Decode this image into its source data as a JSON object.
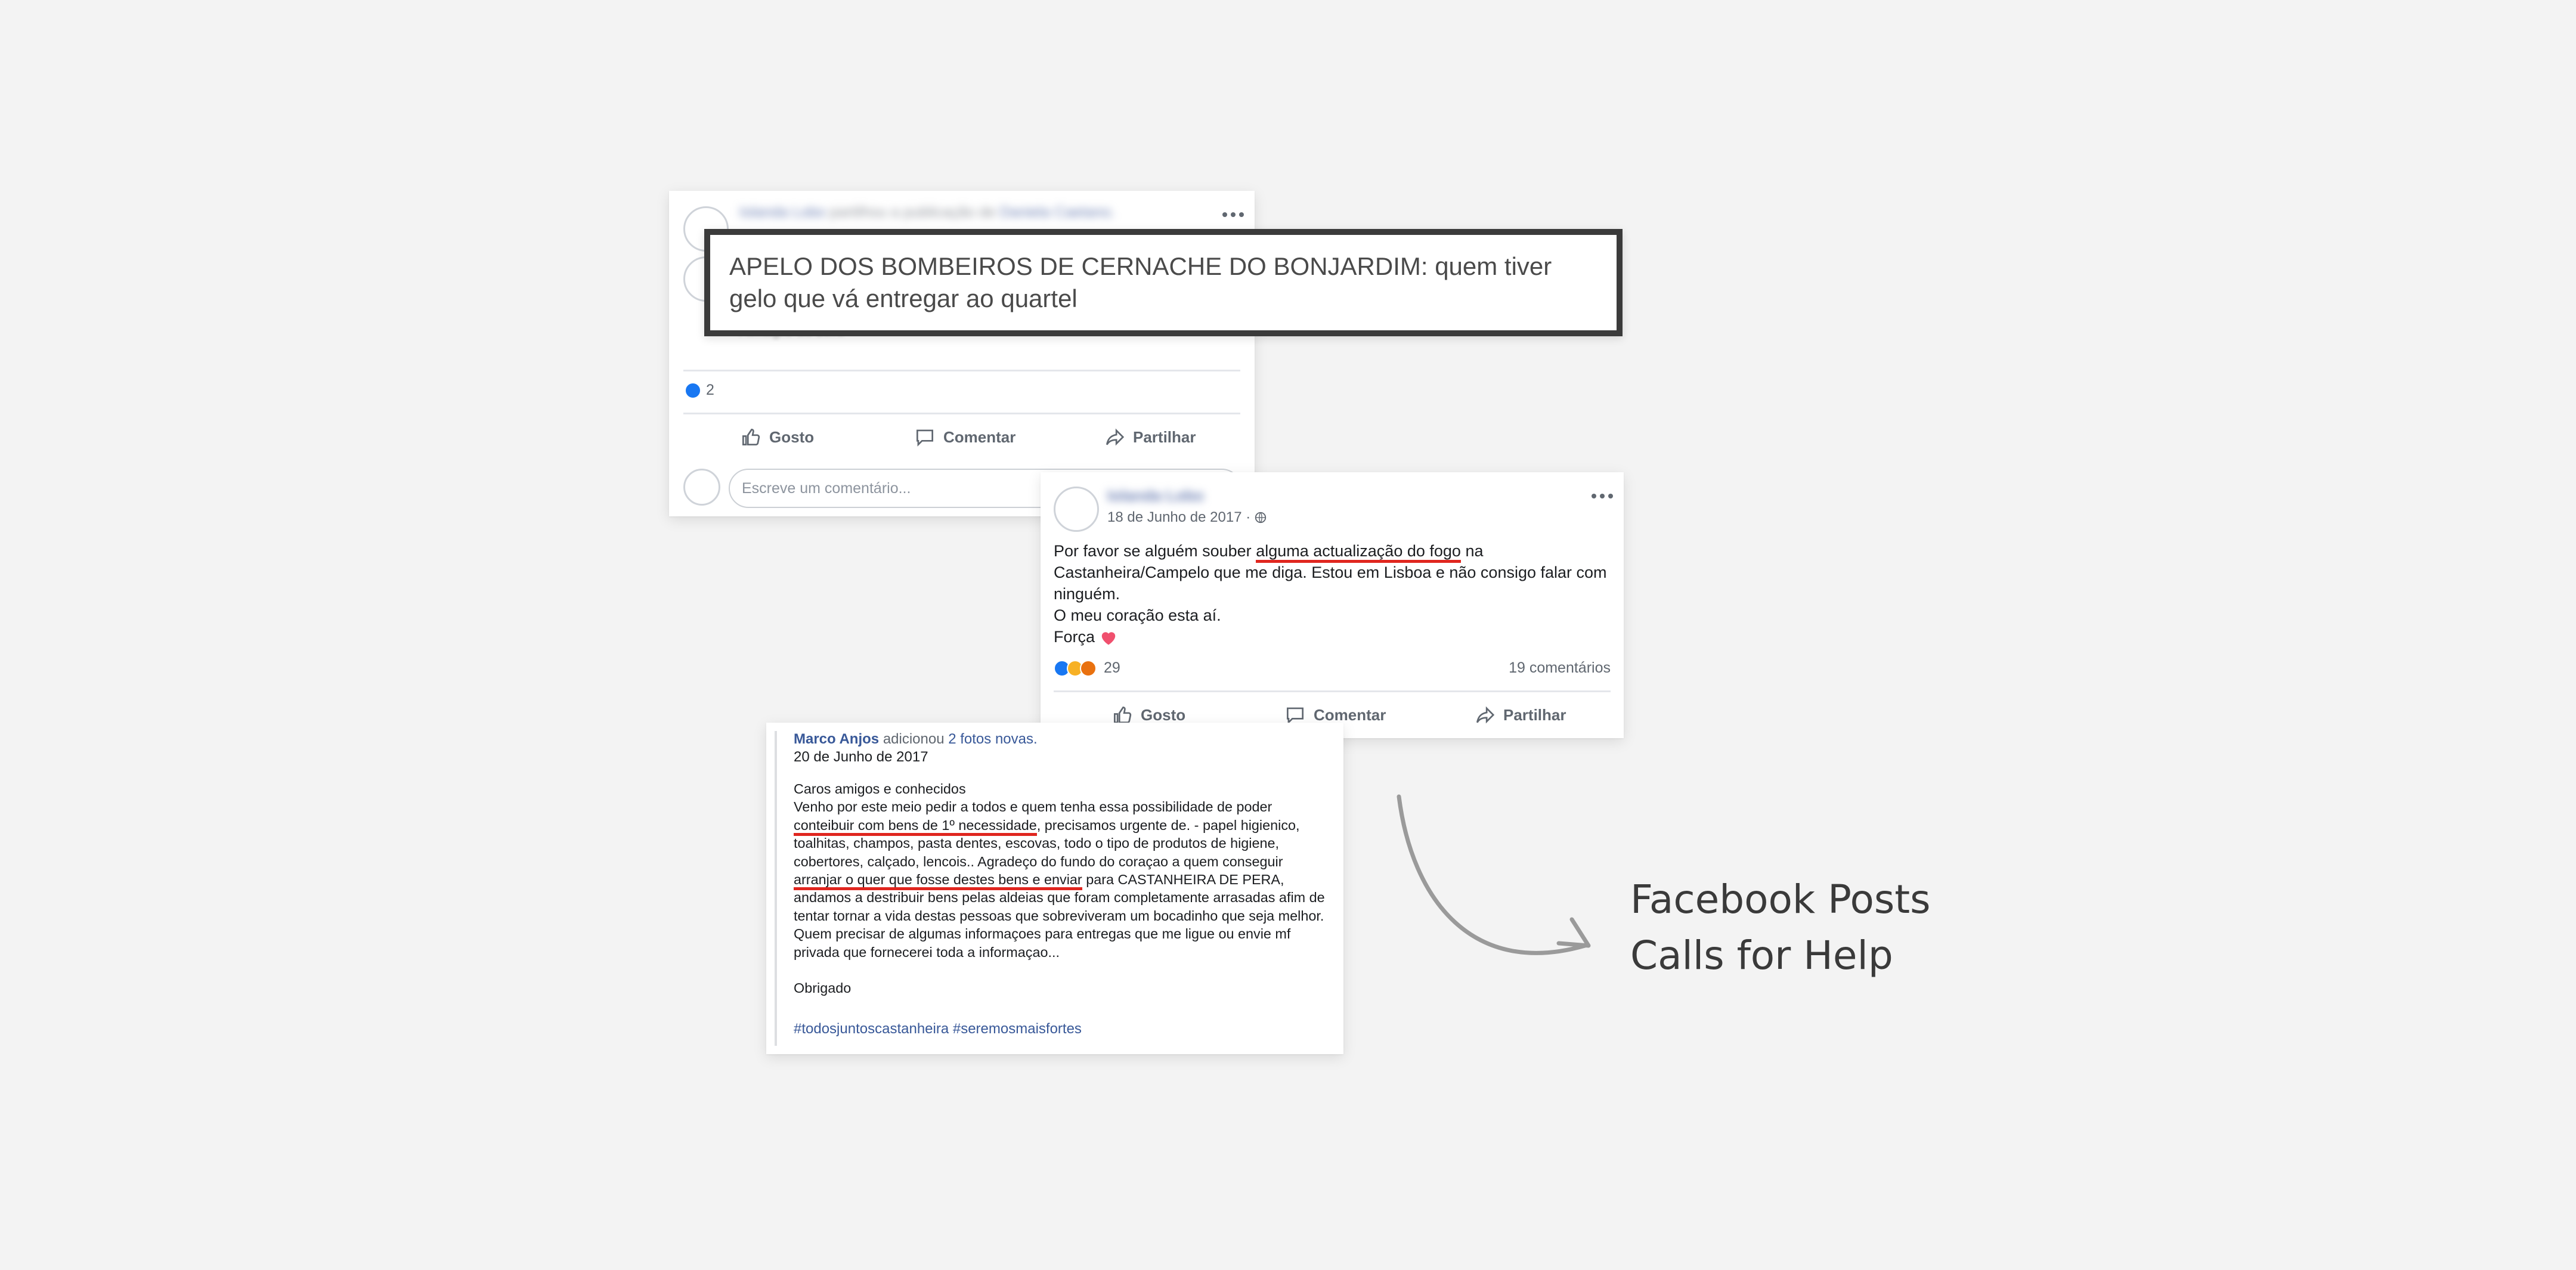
{
  "card1": {
    "header_author": "Iolanda Lobo",
    "header_action": "partilhou a publicação de",
    "header_target": "Daniela Caetano.",
    "faint_text": "Almagre do zero",
    "likes_count": "2",
    "actions": {
      "like": "Gosto",
      "comment": "Comentar",
      "share": "Partilhar"
    },
    "comment_placeholder": "Escreve um comentário..."
  },
  "callout": {
    "text": "APELO DOS BOMBEIROS DE CERNACHE DO BONJARDIM: quem tiver gelo que vá entregar ao quartel"
  },
  "card2": {
    "author": "Iolanda Lobo",
    "date": "18 de Junho de 2017 ·",
    "body_before": "Por favor se alguém souber ",
    "body_highlight": "alguma actualização do fogo",
    "body_after": " na Castanheira/Campelo que me diga. Estou em Lisboa e não consigo falar com ninguém.",
    "line2": "O meu coração esta aí.",
    "line3": "Força",
    "reactions_count": "29",
    "comments_count": "19 comentários",
    "actions": {
      "like": "Gosto",
      "comment": "Comentar",
      "share": "Partilhar"
    }
  },
  "card3": {
    "author": "Marco Anjos",
    "action": "adicionou",
    "photos": "2 fotos novas.",
    "date": "20 de Junho de 2017",
    "greeting": "Caros amigos e conhecidos",
    "p1_a": "Venho por este meio pedir a todos e quem tenha essa possibilidade de poder ",
    "p1_highlight": "conteibuir com bens de 1º necessidade",
    "p1_b": ", precisamos urgente de. - papel higienico, toalhitas, champos, pasta dentes, escovas, todo o tipo de produtos de higiene, cobertores, calçado, lencois.. Agradeço do fundo do coraçao a quem conseguir ",
    "p1_highlight2": "arranjar o quer que fosse destes bens e enviar",
    "p1_c": " para CASTANHEIRA DE PERA, andamos a destribuir bens pelas aldeias que foram completamente arrasadas afim de tentar tornar a vida destas pessoas que sobreviveram um bocadinho que seja melhor.",
    "p2": "Quem precisar de algumas informaçoes para entregas que me ligue ou envie mf privada que fornecerei toda a informaçao...",
    "closing": "Obrigado",
    "tags": "#todosjuntoscastanheira #seremosmaisfortes"
  },
  "caption": {
    "line1": "Facebook Posts",
    "line2": "Calls for Help"
  },
  "colors": {
    "highlight": "#e0261f",
    "link": "#385898",
    "like_blue": "#1877f2",
    "heart": "#f0506e"
  }
}
